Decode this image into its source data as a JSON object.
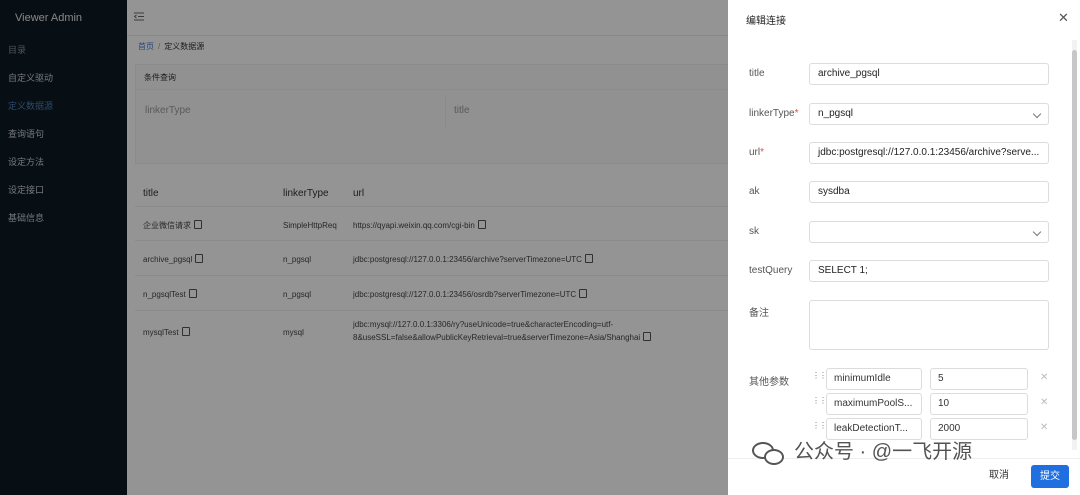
{
  "sidebar": {
    "app_title": "Viewer Admin",
    "items": [
      {
        "label": "目录"
      },
      {
        "label": "自定义驱动"
      },
      {
        "label": "定义数据源"
      },
      {
        "label": "查询语句"
      },
      {
        "label": "设定方法"
      },
      {
        "label": "设定接口"
      },
      {
        "label": "基础信息"
      }
    ]
  },
  "breadcrumb": {
    "home": "首页",
    "current": "定义数据源"
  },
  "filter": {
    "title": "条件查询",
    "linker_label": "linkerType",
    "title_label": "title"
  },
  "table": {
    "headers": [
      "title",
      "linkerType",
      "url"
    ],
    "rows": [
      {
        "title": "企业微信请求",
        "linkerType": "SimpleHttpReq",
        "url": "https://qyapi.weixin.qq.com/cgi-bin"
      },
      {
        "title": "archive_pgsql",
        "linkerType": "n_pgsql",
        "url": "jdbc:postgresql://127.0.0.1:23456/archive?serverTimezone=UTC"
      },
      {
        "title": "n_pgsqlTest",
        "linkerType": "n_pgsql",
        "url": "jdbc:postgresql://127.0.0.1:23456/osrdb?serverTimezone=UTC"
      },
      {
        "title": "mysqlTest",
        "linkerType": "mysql",
        "url_line1": "jdbc:mysql://127.0.0.1:3306/ry?useUnicode=true&characterEncoding=utf-",
        "url_line2": "8&useSSL=false&allowPublicKeyRetrieval=true&serverTimezone=Asia/Shanghai"
      }
    ]
  },
  "drawer": {
    "title": "编辑连接",
    "fields": {
      "title": {
        "label": "title",
        "value": "archive_pgsql"
      },
      "linkerType": {
        "label": "linkerType",
        "value": "n_pgsql"
      },
      "url": {
        "label": "url",
        "value": "jdbc:postgresql://127.0.0.1:23456/archive?serve..."
      },
      "ak": {
        "label": "ak",
        "value": "sysdba"
      },
      "sk": {
        "label": "sk",
        "value": ""
      },
      "testQuery": {
        "label": "testQuery",
        "value": "SELECT 1;"
      },
      "remark": {
        "label": "备注",
        "value": ""
      }
    },
    "params_label": "其他参数",
    "params": [
      {
        "key": "minimumIdle",
        "value": "5"
      },
      {
        "key": "maximumPoolS...",
        "value": "10"
      },
      {
        "key": "leakDetectionT...",
        "value": "2000"
      }
    ],
    "cancel_label": "取消",
    "submit_label": "提交"
  },
  "watermark": "公众号 · @一飞开源",
  "colors": {
    "sidebar_bg": "#0f1a24",
    "primary": "#1f6fe0",
    "required": "#e64a4a"
  }
}
